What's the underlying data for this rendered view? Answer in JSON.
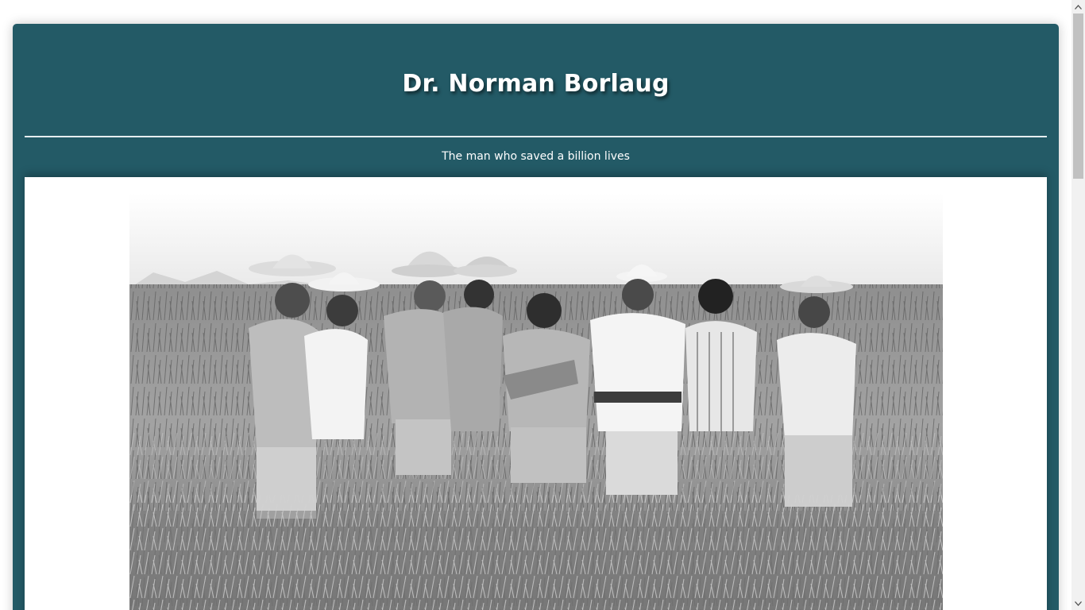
{
  "page": {
    "title": "Dr. Norman Borlaug",
    "tagline": "The man who saved a billion lives"
  },
  "photo": {
    "description_icon": "photo-icon"
  },
  "scrollbar": {
    "up_icon": "arrow-up-icon",
    "down_icon": "arrow-down-icon",
    "position": 0
  },
  "colors": {
    "accent": "#235a66",
    "divider": "#e6eef0",
    "text": "#ffffff"
  }
}
